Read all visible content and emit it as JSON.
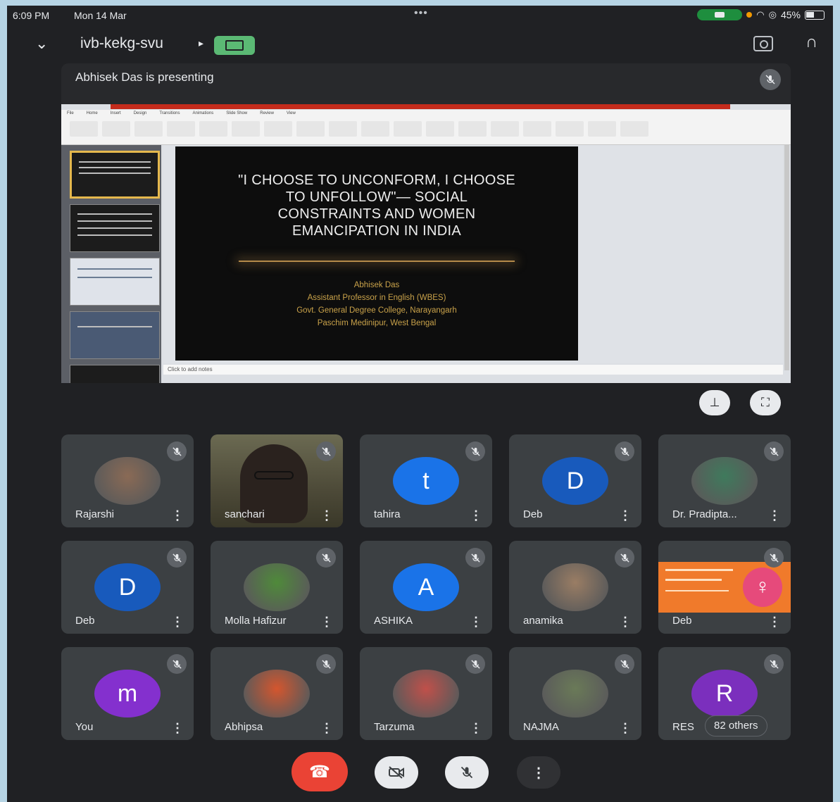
{
  "status_bar": {
    "time": "6:09 PM",
    "date": "Mon 14 Mar",
    "battery": "45%"
  },
  "meeting": {
    "code": "ivb-kekg-svu"
  },
  "presentation": {
    "label": "Abhisek Das is presenting",
    "slide_title_lines": [
      "\"I CHOOSE TO UNCONFORM, I CHOOSE",
      "TO UNFOLLOW\"— SOCIAL",
      "CONSTRAINTS AND WOMEN",
      "EMANCIPATION IN INDIA"
    ],
    "slide_author_lines": [
      "Abhisek Das",
      "Assistant Professor in English (WBES)",
      "Govt. General Degree College, Narayangarh",
      "Paschim Medinipur, West Bengal"
    ],
    "notes_placeholder": "Click to add notes"
  },
  "participants": [
    {
      "name": "Rajarshi",
      "kind": "photo",
      "tone": "#8a6a55"
    },
    {
      "name": "sanchari",
      "kind": "video"
    },
    {
      "name": "tahira",
      "kind": "initial",
      "initial": "t",
      "color": "#1a73e8"
    },
    {
      "name": "Deb",
      "kind": "initial",
      "initial": "D",
      "color": "#185abc"
    },
    {
      "name": "Dr. Pradipta...",
      "kind": "photo",
      "tone": "#3f7a5c"
    },
    {
      "name": "Deb",
      "kind": "initial",
      "initial": "D",
      "color": "#185abc"
    },
    {
      "name": "Molla Hafizur",
      "kind": "photo",
      "tone": "#4f8a3a"
    },
    {
      "name": "ASHIKA",
      "kind": "initial",
      "initial": "A",
      "color": "#1a73e8"
    },
    {
      "name": "anamika",
      "kind": "photo",
      "tone": "#9a7d64"
    },
    {
      "name": "Deb",
      "kind": "banner"
    },
    {
      "name": "You",
      "kind": "initial",
      "initial": "m",
      "color": "#8430ce"
    },
    {
      "name": "Abhipsa",
      "kind": "photo",
      "tone": "#d4562e"
    },
    {
      "name": "Tarzuma",
      "kind": "photo",
      "tone": "#c0504a"
    },
    {
      "name": "NAJMA",
      "kind": "photo",
      "tone": "#6a7a58"
    },
    {
      "name": "RES",
      "kind": "initial",
      "initial": "R",
      "color": "#7b2fbd",
      "others": "82 others"
    }
  ]
}
